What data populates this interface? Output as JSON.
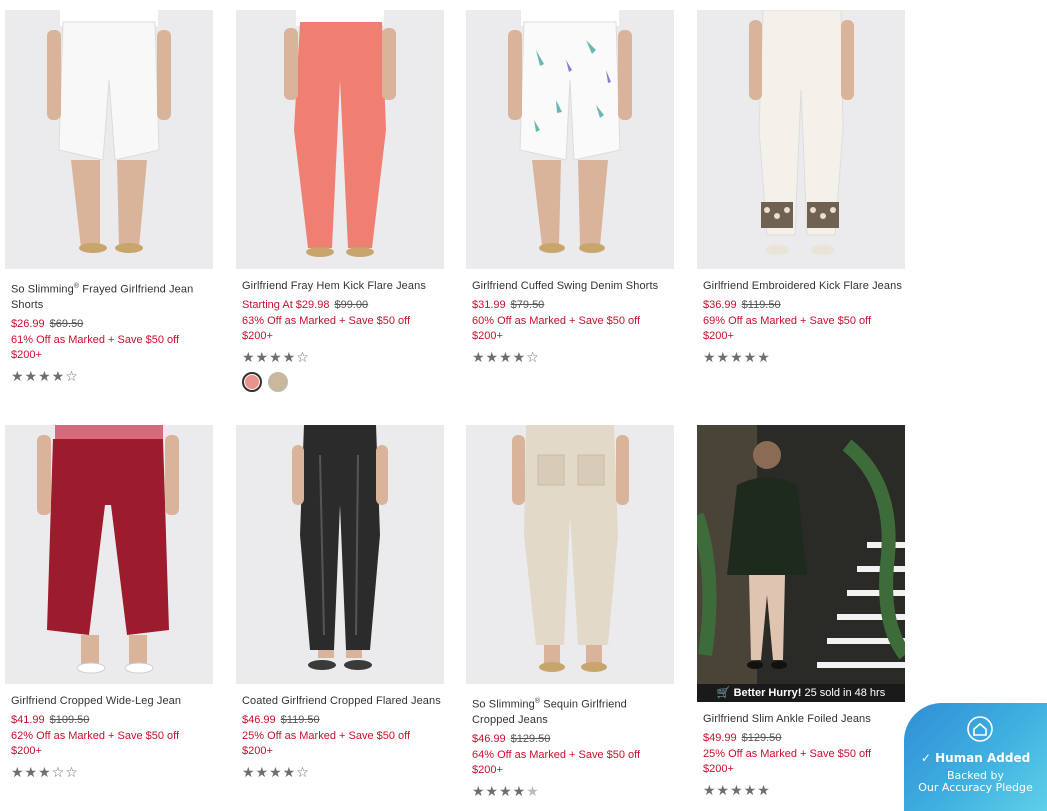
{
  "products": [
    {
      "name": "So Slimming",
      "name_suffix": " Frayed Girlfriend Jean Shorts",
      "reg": "®",
      "price_now": "$26.99",
      "price_was": "$69.50",
      "promo": "61% Off as Marked + Save $50 off $200+",
      "rating": 4,
      "stars": "★★★★☆"
    },
    {
      "name": "Girlfriend Fray Hem Kick Flare Jeans",
      "price_now": "Starting At $29.98",
      "price_was": "$99.00",
      "promo": "63% Off as Marked + Save $50 off $200+",
      "rating": 4,
      "stars": "★★★★☆",
      "swatches": [
        "#e8948c",
        "#c9b89c"
      ]
    },
    {
      "name": "Girlfriend Cuffed Swing Denim Shorts",
      "price_now": "$31.99",
      "price_was": "$79.50",
      "promo": "60% Off as Marked + Save $50 off $200+",
      "rating": 4,
      "stars": "★★★★☆"
    },
    {
      "name": "Girlfriend Embroidered Kick Flare Jeans",
      "price_now": "$36.99",
      "price_was": "$119.50",
      "promo": "69% Off as Marked + Save $50 off $200+",
      "rating": 5,
      "stars": "★★★★★"
    },
    {
      "name": "Girlfriend Cropped Wide-Leg Jean",
      "price_now": "$41.99",
      "price_was": "$109.50",
      "promo": "62% Off as Marked + Save $50 off $200+",
      "rating": 3,
      "stars": "★★★☆☆"
    },
    {
      "name": "Coated Girlfriend Cropped Flared Jeans",
      "price_now": "$46.99",
      "price_was": "$119.50",
      "promo": "25% Off as Marked + Save $50 off $200+",
      "rating": 4,
      "stars": "★★★★☆"
    },
    {
      "name": "So Slimming",
      "name_suffix": " Sequin Girlfriend Cropped Jeans",
      "reg": "®",
      "price_now": "$46.99",
      "price_was": "$129.50",
      "promo": "64% Off as Marked + Save $50 off $200+",
      "rating": 4.5,
      "stars": "★★★★"
    },
    {
      "name": "Girlfriend Slim Ankle Foiled Jeans",
      "price_now": "$49.99",
      "price_was": "$129.50",
      "promo": "25% Off as Marked + Save $50 off $200+",
      "rating": 5,
      "stars": "★★★★★",
      "hurry_bold": "Better Hurry!",
      "hurry_text": " 25 sold in 48 hrs"
    }
  ],
  "badge": {
    "title": "Human Added",
    "line2": "Backed by",
    "line3": "Our Accuracy Pledge"
  },
  "colors": {
    "sale_red": "#c8102e",
    "star_gray": "#6e6e6e",
    "badge_blue": "#3fb0e0"
  },
  "icons": {
    "cart": "cart-icon",
    "badge_home": "house-icon",
    "badge_check": "check-circle-icon"
  }
}
